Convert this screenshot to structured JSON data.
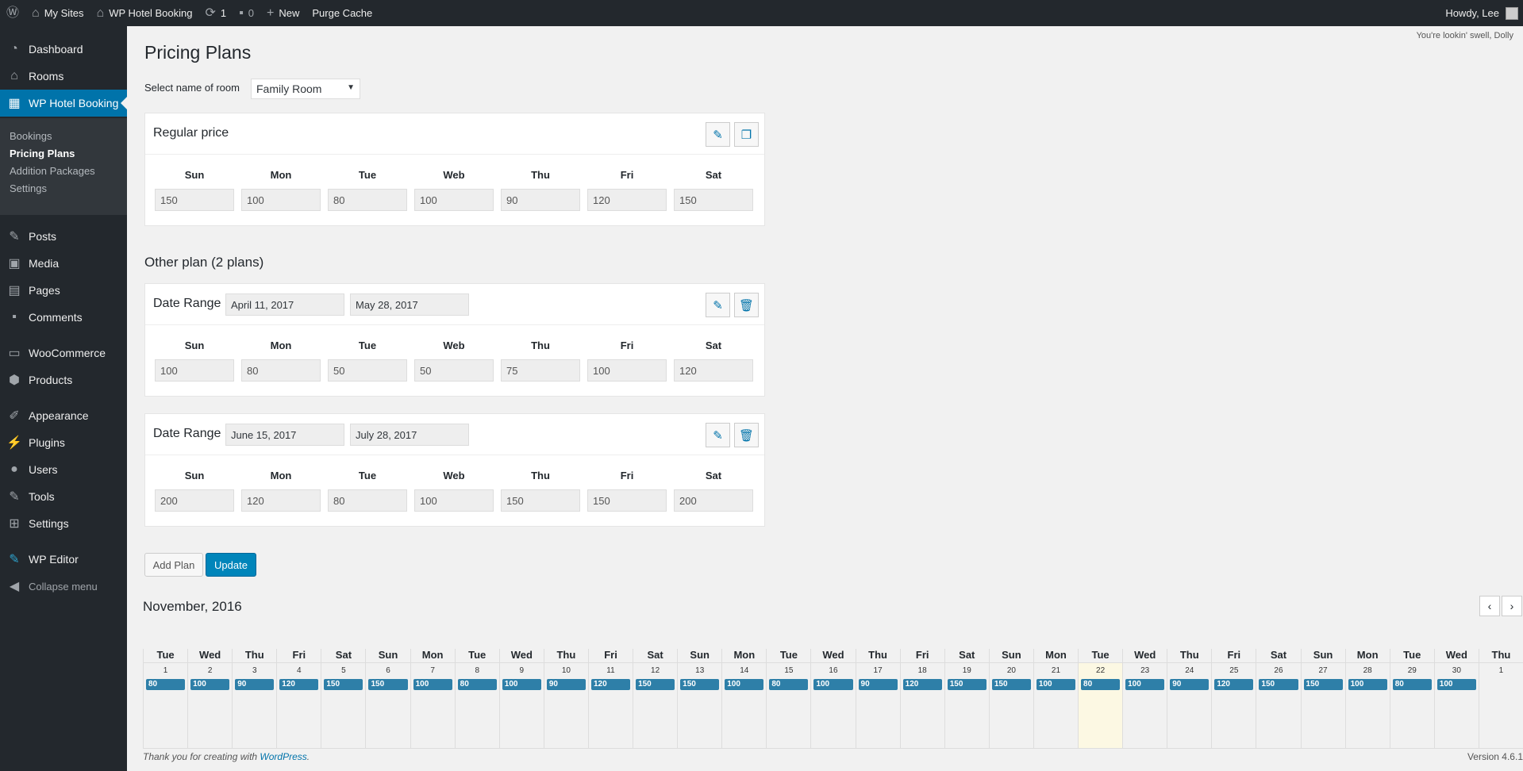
{
  "adminbar": {
    "my_sites": "My Sites",
    "site_name": "WP Hotel Booking",
    "updates_count": "1",
    "comments_count": "0",
    "new_label": "New",
    "purge_cache": "Purge Cache",
    "howdy": "Howdy, Lee"
  },
  "menu": {
    "dashboard": "Dashboard",
    "rooms": "Rooms",
    "hotel_booking": "WP Hotel Booking",
    "sub_bookings": "Bookings",
    "sub_pricing": "Pricing Plans",
    "sub_addition": "Addition Packages",
    "sub_settings": "Settings",
    "posts": "Posts",
    "media": "Media",
    "pages": "Pages",
    "comments": "Comments",
    "woocommerce": "WooCommerce",
    "products": "Products",
    "appearance": "Appearance",
    "plugins": "Plugins",
    "users": "Users",
    "tools": "Tools",
    "settings": "Settings",
    "wp_editor": "WP Editor",
    "collapse": "Collapse menu"
  },
  "dolly": "You're lookin' swell, Dolly",
  "page_title": "Pricing Plans",
  "room_select_label": "Select name of room",
  "room_selected": "Family Room",
  "days": [
    "Sun",
    "Mon",
    "Tue",
    "Web",
    "Thu",
    "Fri",
    "Sat"
  ],
  "regular": {
    "title": "Regular price",
    "prices": [
      "150",
      "100",
      "80",
      "100",
      "90",
      "120",
      "150"
    ]
  },
  "other_title": "Other plan (2 plans)",
  "plans": [
    {
      "label": "Date Range",
      "start": "April 11, 2017",
      "end": "May 28, 2017",
      "prices": [
        "100",
        "80",
        "50",
        "50",
        "75",
        "100",
        "120"
      ]
    },
    {
      "label": "Date Range",
      "start": "June 15, 2017",
      "end": "July 28, 2017",
      "prices": [
        "200",
        "120",
        "80",
        "100",
        "150",
        "150",
        "200"
      ]
    }
  ],
  "add_plan": "Add Plan",
  "update": "Update",
  "calendar": {
    "month": "November, 2016",
    "columns": [
      {
        "dow": "Tue",
        "date": "1",
        "price": "80"
      },
      {
        "dow": "Wed",
        "date": "2",
        "price": "100"
      },
      {
        "dow": "Thu",
        "date": "3",
        "price": "90"
      },
      {
        "dow": "Fri",
        "date": "4",
        "price": "120"
      },
      {
        "dow": "Sat",
        "date": "5",
        "price": "150"
      },
      {
        "dow": "Sun",
        "date": "6",
        "price": "150"
      },
      {
        "dow": "Mon",
        "date": "7",
        "price": "100"
      },
      {
        "dow": "Tue",
        "date": "8",
        "price": "80"
      },
      {
        "dow": "Wed",
        "date": "9",
        "price": "100"
      },
      {
        "dow": "Thu",
        "date": "10",
        "price": "90"
      },
      {
        "dow": "Fri",
        "date": "11",
        "price": "120"
      },
      {
        "dow": "Sat",
        "date": "12",
        "price": "150"
      },
      {
        "dow": "Sun",
        "date": "13",
        "price": "150"
      },
      {
        "dow": "Mon",
        "date": "14",
        "price": "100"
      },
      {
        "dow": "Tue",
        "date": "15",
        "price": "80"
      },
      {
        "dow": "Wed",
        "date": "16",
        "price": "100"
      },
      {
        "dow": "Thu",
        "date": "17",
        "price": "90"
      },
      {
        "dow": "Fri",
        "date": "18",
        "price": "120"
      },
      {
        "dow": "Sat",
        "date": "19",
        "price": "150"
      },
      {
        "dow": "Sun",
        "date": "20",
        "price": "150"
      },
      {
        "dow": "Mon",
        "date": "21",
        "price": "100"
      },
      {
        "dow": "Tue",
        "date": "22",
        "price": "80",
        "today": true
      },
      {
        "dow": "Wed",
        "date": "23",
        "price": "100"
      },
      {
        "dow": "Thu",
        "date": "24",
        "price": "90"
      },
      {
        "dow": "Fri",
        "date": "25",
        "price": "120"
      },
      {
        "dow": "Sat",
        "date": "26",
        "price": "150"
      },
      {
        "dow": "Sun",
        "date": "27",
        "price": "150"
      },
      {
        "dow": "Mon",
        "date": "28",
        "price": "100"
      },
      {
        "dow": "Tue",
        "date": "29",
        "price": "80"
      },
      {
        "dow": "Wed",
        "date": "30",
        "price": "100"
      },
      {
        "dow": "Thu",
        "date": "1",
        "price": ""
      }
    ]
  },
  "footer": {
    "thanks_prefix": "Thank you for creating with ",
    "wordpress": "WordPress",
    "thanks_suffix": ".",
    "version": "Version 4.6.1"
  },
  "colors": {
    "admin_dark": "#23282d",
    "accent": "#0073aa",
    "price_badge": "#2e7fa8",
    "today_bg": "#fcf8e3"
  }
}
